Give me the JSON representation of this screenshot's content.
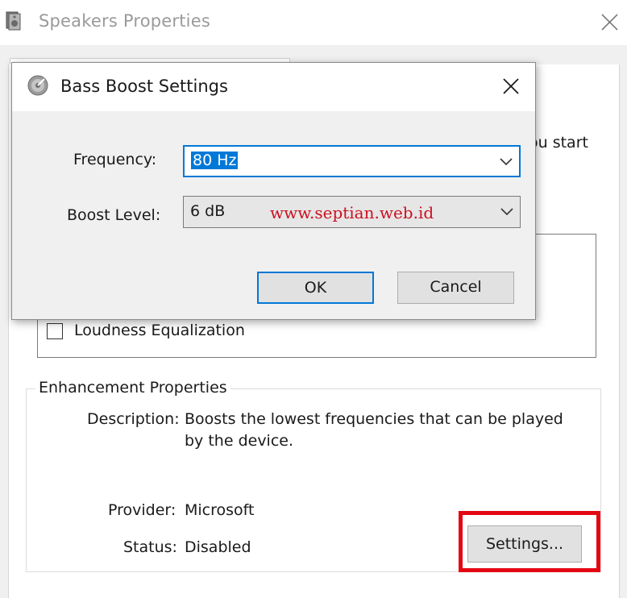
{
  "main_window": {
    "title": "Speakers Properties",
    "intro_text_fragment": "ou start",
    "enhancement_item": "Loudness Equalization",
    "enhancement_item_checked": false,
    "properties": {
      "group_label": "Enhancement Properties",
      "description_label": "Description:",
      "description_line1": "Boosts the lowest frequencies that can be played",
      "description_line2": "by the device.",
      "provider_label": "Provider:",
      "provider_value": "Microsoft",
      "status_label": "Status:",
      "status_value": "Disabled",
      "settings_button": "Settings..."
    },
    "highlight_color": "#e30613"
  },
  "dialog": {
    "title": "Bass Boost Settings",
    "frequency_label": "Frequency:",
    "frequency_value": "80 Hz",
    "boost_label": "Boost Level:",
    "boost_value": "6 dB",
    "watermark": "www.septian.web.id",
    "ok_button": "OK",
    "cancel_button": "Cancel",
    "accent_color": "#0078d7"
  },
  "icons": {
    "app_icon": "speaker-properties-icon",
    "dialog_icon": "speaker-disc-icon",
    "close_icon": "close-icon",
    "dropdown_icon": "chevron-down-icon"
  }
}
